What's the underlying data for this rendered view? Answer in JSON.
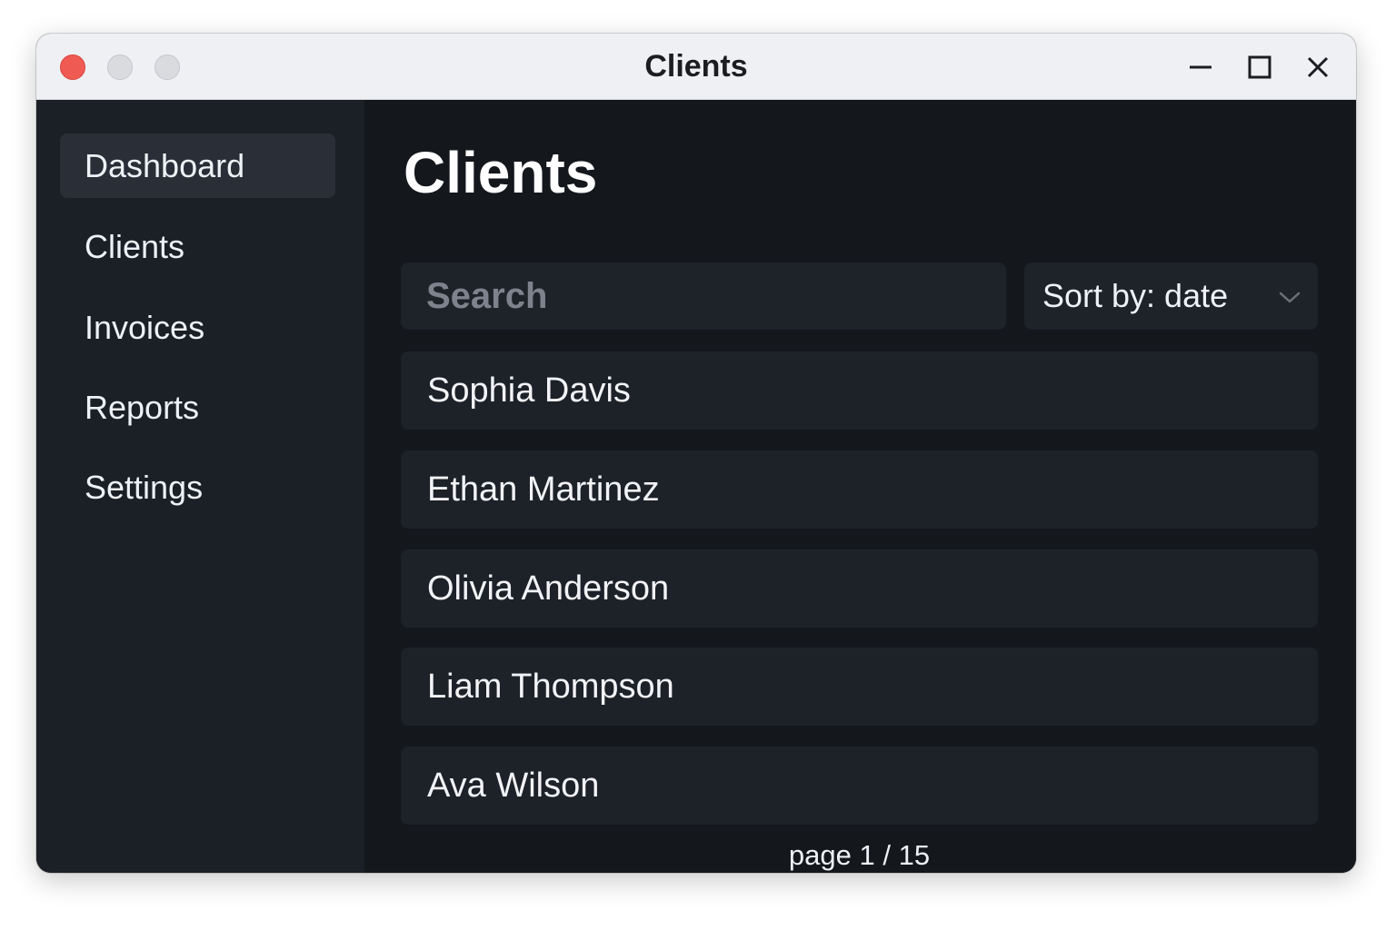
{
  "window": {
    "title": "Clients"
  },
  "sidebar": {
    "items": [
      {
        "label": "Dashboard",
        "active": true
      },
      {
        "label": "Clients",
        "active": false
      },
      {
        "label": "Invoices",
        "active": false
      },
      {
        "label": "Reports",
        "active": false
      },
      {
        "label": "Settings",
        "active": false
      }
    ]
  },
  "main": {
    "title": "Clients",
    "search": {
      "placeholder": "Search",
      "value": ""
    },
    "sort": {
      "label": "Sort by: date",
      "icon": "chevron-down-icon"
    },
    "clients": [
      "Sophia Davis",
      "Ethan Martinez",
      "Olivia Anderson",
      "Liam Thompson",
      "Ava Wilson"
    ],
    "pagination": "page 1 / 15"
  },
  "colors": {
    "sidebar_bg": "#1b1f26",
    "main_bg": "#14171c",
    "active_item_bg": "#2a2f37",
    "row_bg": "#1d2128",
    "close_dot": "#ef5a52",
    "titlebar_bg": "#eef0f4"
  }
}
